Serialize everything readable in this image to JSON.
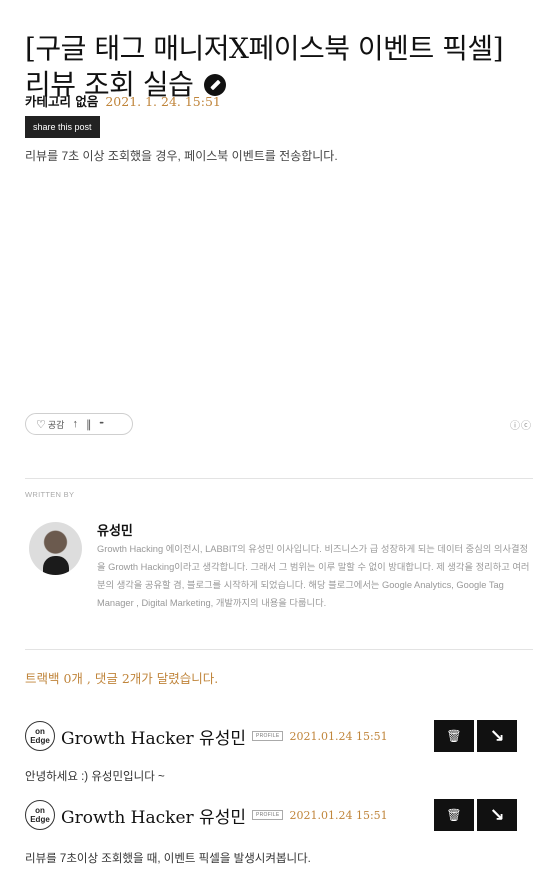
{
  "post": {
    "title_line1": "[구글 태그 매니저X페이스북 이벤트 픽셀]",
    "title_line2": "리뷰 조회 실습",
    "category": "카테고리 없음",
    "date": "2021. 1. 24. 15:51",
    "share_label": "share this post",
    "body": "리뷰를 7초 이상 조회했을 경우, 페이스북 이벤트를 전송합니다."
  },
  "actions": {
    "like_label": "공감",
    "ccl": "ⓘⓒ"
  },
  "author": {
    "written_by": "WRITTEN BY",
    "name": "유성민",
    "description": "Growth Hacking 에이전시, LABBIT의 유성민 이사입니다. 비즈니스가 급 성장하게 되는 데이터 중심의 의사결정을 Growth Hacking이라고 생각합니다. 그래서 그 범위는 이루 말할 수 없이 방대합니다. 제 생각을 정리하고 여러분의 생각을 공유할 겸, 블로그를 시작하게 되었습니다. 해당 블로그에서는 Google Analytics, Google Tag Manager , Digital Marketing, 개발까지의 내용을 다룹니다."
  },
  "comments_summary": "트랙백  0개 , 댓글  2개가 달렸습니다.",
  "comments": [
    {
      "logo_top": "on",
      "logo_bottom": "Edge",
      "author": "Growth Hacker 유성민",
      "badge": "PROFILE",
      "date": "2021.01.24 15:51",
      "text": "안녕하세요 :) 유성민입니다 ~"
    },
    {
      "logo_top": "on",
      "logo_bottom": "Edge",
      "author": "Growth Hacker 유성민",
      "badge": "PROFILE",
      "date": "2021.01.24 15:51",
      "text": "리뷰를 7초이상 조회했을 때, 이벤트 픽셀을 발생시켜봅니다."
    }
  ]
}
